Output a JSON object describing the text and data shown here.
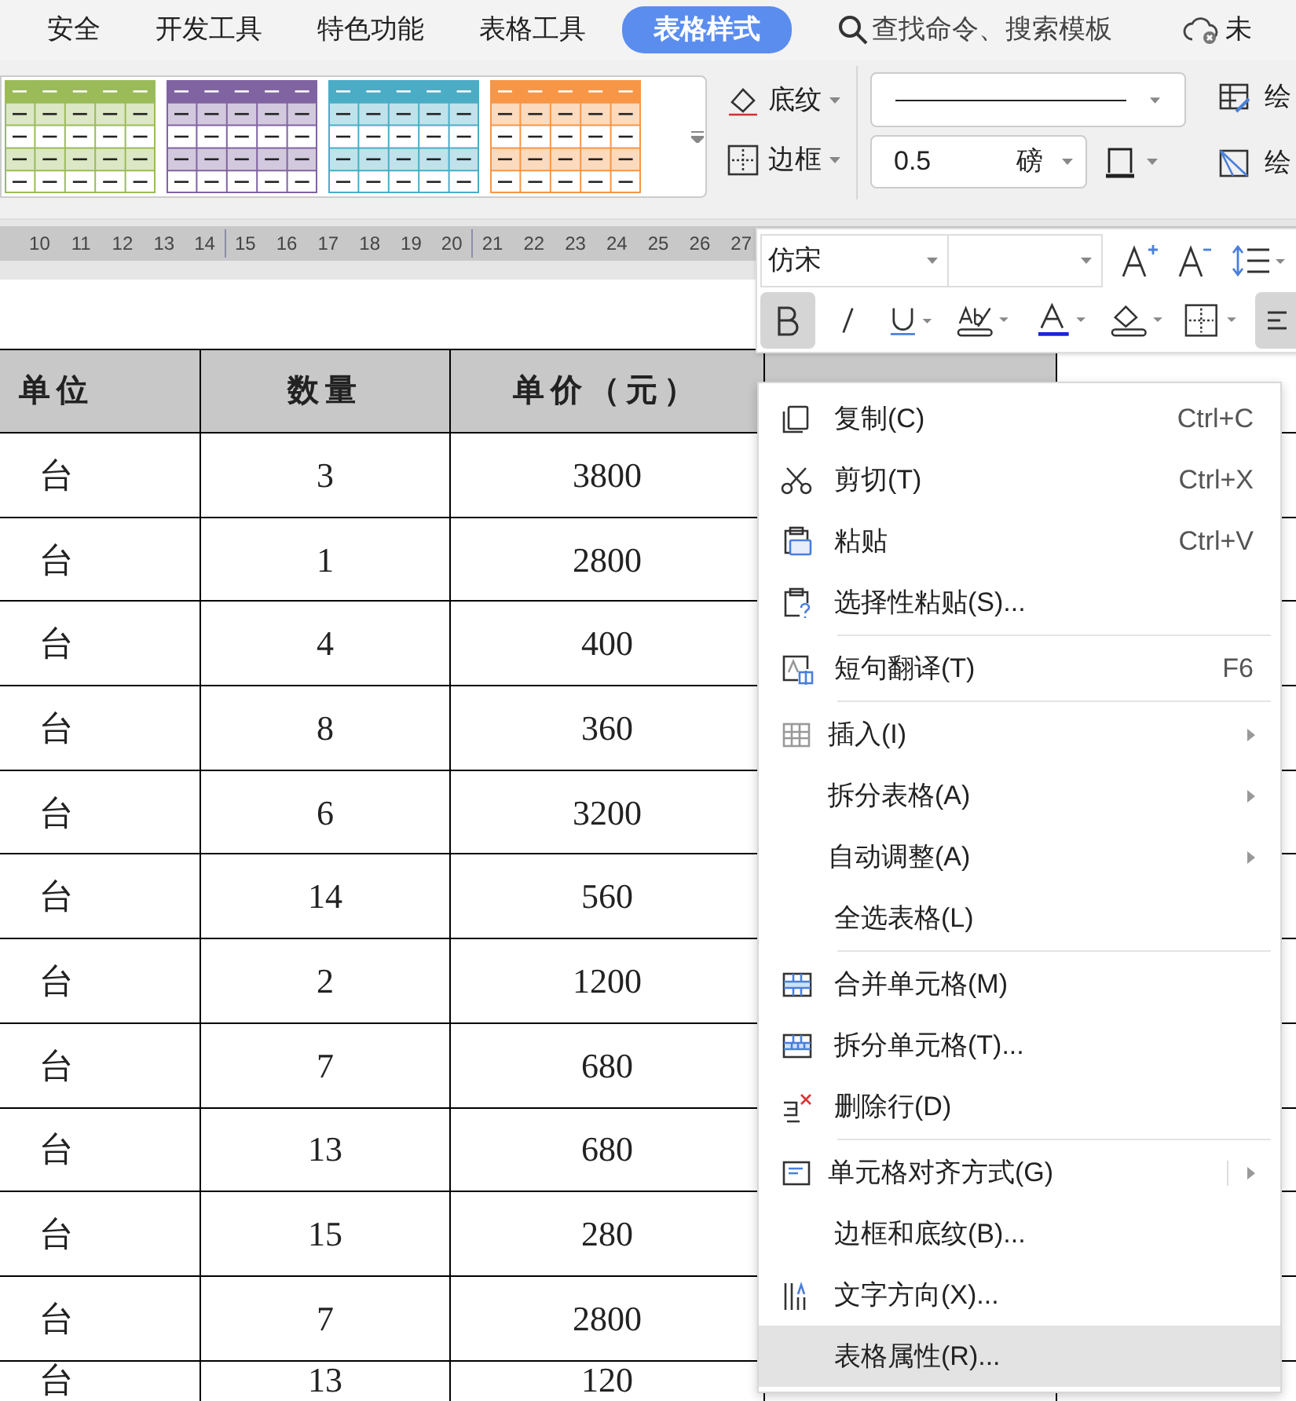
{
  "tabs": [
    {
      "label": "安全",
      "selected": false
    },
    {
      "label": "开发工具",
      "selected": false
    },
    {
      "label": "特色功能",
      "selected": false
    },
    {
      "label": "表格工具",
      "selected": false
    },
    {
      "label": "表格样式",
      "selected": true
    }
  ],
  "search": {
    "placeholder": "查找命令、搜索模板"
  },
  "cloud_label": "未",
  "style_gallery": [
    {
      "color": "#9bbb59"
    },
    {
      "color": "#8064a2"
    },
    {
      "color": "#4bacc6"
    },
    {
      "color": "#f79646"
    }
  ],
  "ribbon_buttons": [
    {
      "label": "底纹"
    },
    {
      "label": "边框"
    }
  ],
  "line_width": {
    "value": "0.5",
    "unit": "磅"
  },
  "draw_buttons": [
    {
      "label": "绘"
    },
    {
      "label": "绘"
    }
  ],
  "ruler": [
    "10",
    "11",
    "12",
    "13",
    "14",
    "15",
    "16",
    "17",
    "18",
    "19",
    "20",
    "21",
    "22",
    "23",
    "24",
    "25",
    "26",
    "27"
  ],
  "mini_toolbar": {
    "font": "仿宋",
    "bold_selected": true
  },
  "table": {
    "columns": [
      "单位",
      "数量",
      "单价（元）"
    ],
    "rows": [
      [
        "台",
        "3",
        "3800"
      ],
      [
        "台",
        "1",
        "2800"
      ],
      [
        "台",
        "4",
        "400"
      ],
      [
        "台",
        "8",
        "360"
      ],
      [
        "台",
        "6",
        "3200"
      ],
      [
        "台",
        "14",
        "560"
      ],
      [
        "台",
        "2",
        "1200"
      ],
      [
        "台",
        "7",
        "680"
      ],
      [
        "台",
        "13",
        "680"
      ],
      [
        "台",
        "15",
        "280"
      ],
      [
        "台",
        "7",
        "2800"
      ],
      [
        "台",
        "13",
        "120"
      ]
    ]
  },
  "context_menu": [
    {
      "label": "复制(C)",
      "shortcut": "Ctrl+C",
      "submenu": false,
      "separator_after": false,
      "highlighted": false
    },
    {
      "label": "剪切(T)",
      "shortcut": "Ctrl+X",
      "submenu": false,
      "separator_after": false,
      "highlighted": false
    },
    {
      "label": "粘贴",
      "shortcut": "Ctrl+V",
      "submenu": false,
      "separator_after": false,
      "highlighted": false
    },
    {
      "label": "选择性粘贴(S)...",
      "submenu": false,
      "separator_after": true,
      "highlighted": false
    },
    {
      "label": "短句翻译(T)",
      "shortcut": "F6",
      "submenu": false,
      "separator_after": true,
      "highlighted": false
    },
    {
      "label": "插入(I)",
      "submenu": true,
      "separator_after": false,
      "highlighted": false
    },
    {
      "label": "拆分表格(A)",
      "submenu": true,
      "separator_after": false,
      "highlighted": false
    },
    {
      "label": "自动调整(A)",
      "submenu": true,
      "separator_after": false,
      "highlighted": false
    },
    {
      "label": "全选表格(L)",
      "submenu": false,
      "separator_after": true,
      "highlighted": false
    },
    {
      "label": "合并单元格(M)",
      "submenu": false,
      "separator_after": false,
      "highlighted": false
    },
    {
      "label": "拆分单元格(T)...",
      "submenu": false,
      "separator_after": false,
      "highlighted": false
    },
    {
      "label": "删除行(D)",
      "submenu": false,
      "separator_after": true,
      "highlighted": false
    },
    {
      "label": "单元格对齐方式(G)",
      "submenu": true,
      "separator_after": false,
      "highlighted": false
    },
    {
      "label": "边框和底纹(B)...",
      "submenu": false,
      "separator_after": false,
      "highlighted": false
    },
    {
      "label": "文字方向(X)...",
      "submenu": false,
      "separator_after": false,
      "highlighted": false
    },
    {
      "label": "表格属性(R)...",
      "submenu": false,
      "separator_after": false,
      "highlighted": true
    }
  ]
}
